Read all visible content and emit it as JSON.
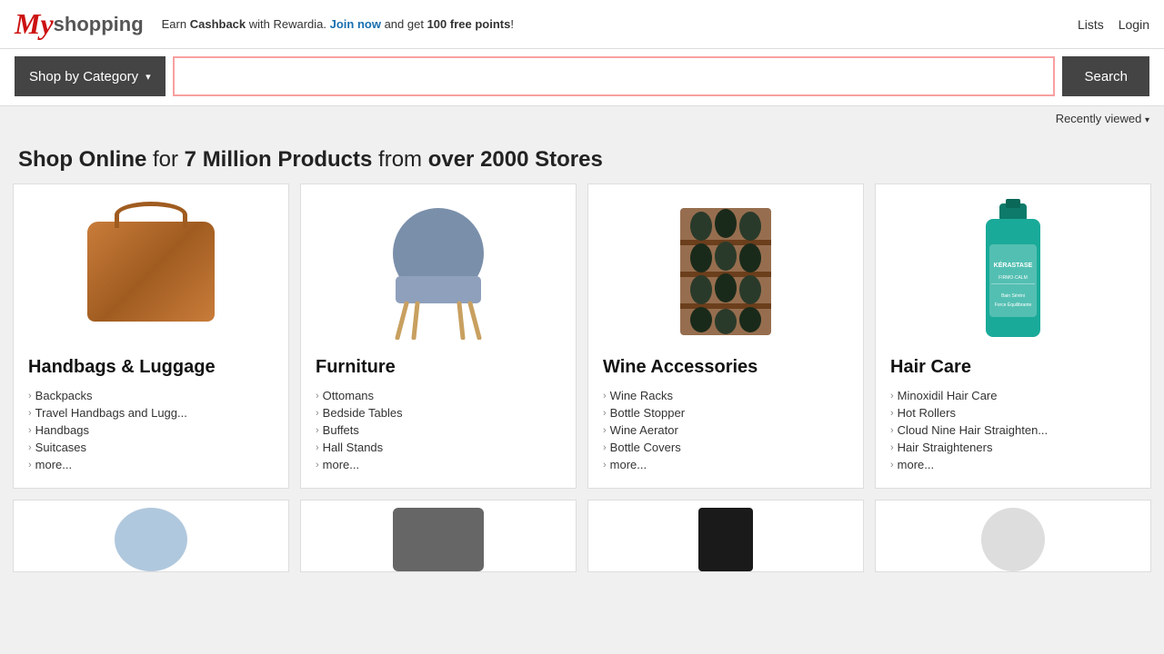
{
  "header": {
    "logo_my": "My",
    "logo_shopping": "shopping",
    "cashback_prefix": "Earn ",
    "cashback_bold1": "Cashback",
    "cashback_mid": " with Rewardia. ",
    "cashback_link": "Join now",
    "cashback_suffix": " and get ",
    "cashback_bold2": "100 free points",
    "cashback_end": "!",
    "links": [
      {
        "label": "Lists",
        "name": "lists-link"
      },
      {
        "label": "Login",
        "name": "login-link"
      }
    ]
  },
  "search": {
    "shop_by_label": "Shop by Category",
    "search_label": "Search",
    "input_placeholder": "",
    "recently_viewed_label": "Recently viewed"
  },
  "hero": {
    "part1": "Shop Online",
    "part2": " for ",
    "part3": "7 Million Products",
    "part4": " from ",
    "part5": "over 2000 Stores"
  },
  "categories": [
    {
      "id": "handbags",
      "title": "Handbags & Luggage",
      "links": [
        "Backpacks",
        "Travel Handbags and Lugg...",
        "Handbags",
        "Suitcases",
        "more..."
      ]
    },
    {
      "id": "furniture",
      "title": "Furniture",
      "links": [
        "Ottomans",
        "Bedside Tables",
        "Buffets",
        "Hall Stands",
        "more..."
      ]
    },
    {
      "id": "wine",
      "title": "Wine Accessories",
      "links": [
        "Wine Racks",
        "Bottle Stopper",
        "Wine Aerator",
        "Bottle Covers",
        "more..."
      ]
    },
    {
      "id": "haircare",
      "title": "Hair Care",
      "links": [
        "Minoxidil Hair Care",
        "Hot Rollers",
        "Cloud Nine Hair Straighten...",
        "Hair Straighteners",
        "more..."
      ]
    }
  ]
}
